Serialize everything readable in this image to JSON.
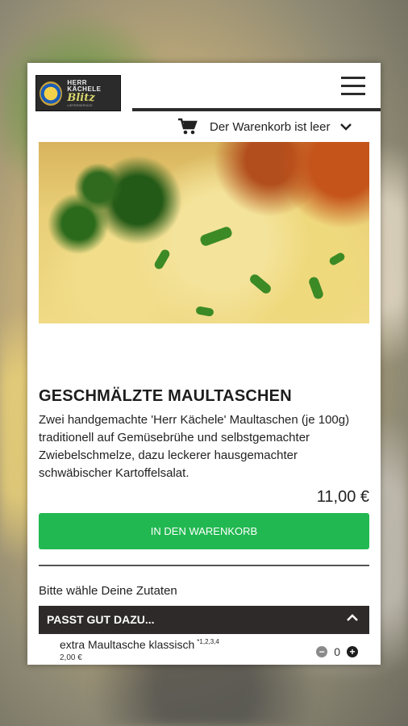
{
  "header": {
    "logo": {
      "line1": "HERR KÄCHELE",
      "line2": "Blitz",
      "line3": "LIEFERSERVICE"
    },
    "menu_icon": "hamburger-icon"
  },
  "cart": {
    "icon": "cart-icon",
    "label": "Der Warenkorb ist leer"
  },
  "dish": {
    "title": "GESCHMÄLZTE MAULTASCHEN",
    "description": "Zwei handgemachte 'Herr Kächele' Maultaschen (je 100g) traditionell auf Gemüsebrühe und selbstgemachter Zwiebelschmelze, dazu leckerer hausgemachter schwäbischer Kartoffelsalat.",
    "price": "11,00 €",
    "add_button": "IN DEN WARENKORB"
  },
  "options": {
    "prompt": "Bitte wähle Deine Zutaten",
    "section_title": "PASST GUT DAZU...",
    "items": [
      {
        "name": "extra Maultasche klassisch",
        "notes": "*1,2,3,4",
        "price": "2,00 €",
        "qty": "0"
      }
    ]
  },
  "colors": {
    "accent": "#22b851",
    "dark": "#2e2a29",
    "minus": "#8a8a8a",
    "plus": "#1d1d1d"
  }
}
